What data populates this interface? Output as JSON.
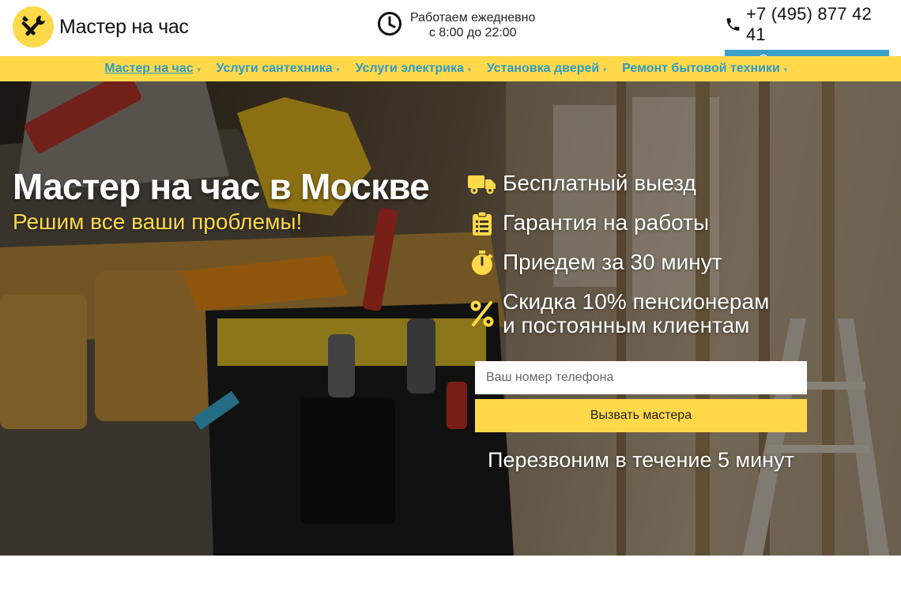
{
  "header": {
    "logo_text": "Мастер на час",
    "hours_line1": "Работаем ежедневно",
    "hours_line2": "с 8:00 до 22:00",
    "phone": "+7 (495) 877 42 41",
    "request_button": "Оставить заявку"
  },
  "nav": {
    "items": [
      {
        "label": "Мастер на час",
        "active": true
      },
      {
        "label": "Услуги сантехника",
        "active": false
      },
      {
        "label": "Услуги электрика",
        "active": false
      },
      {
        "label": "Установка дверей",
        "active": false
      },
      {
        "label": "Ремонт бытовой техники",
        "active": false
      }
    ]
  },
  "hero": {
    "title": "Мастер на час в Москве",
    "subtitle": "Решим все ваши проблемы!",
    "features": [
      {
        "icon": "truck-icon",
        "text": "Бесплатный выезд"
      },
      {
        "icon": "clipboard-icon",
        "text": "Гарантия на работы"
      },
      {
        "icon": "stopwatch-icon",
        "text": "Приедем за 30 минут"
      },
      {
        "icon": "percent-icon",
        "text": "Скидка 10% пенсионерам и постоянным клиентам"
      }
    ],
    "phone_placeholder": "Ваш номер телефона",
    "call_button": "Вызвать мастера",
    "callback_note": "Перезвоним в течение 5 минут"
  },
  "colors": {
    "accent_yellow": "#ffd94a",
    "accent_blue": "#3aa0c8",
    "nav_link": "#2f9bc4"
  }
}
